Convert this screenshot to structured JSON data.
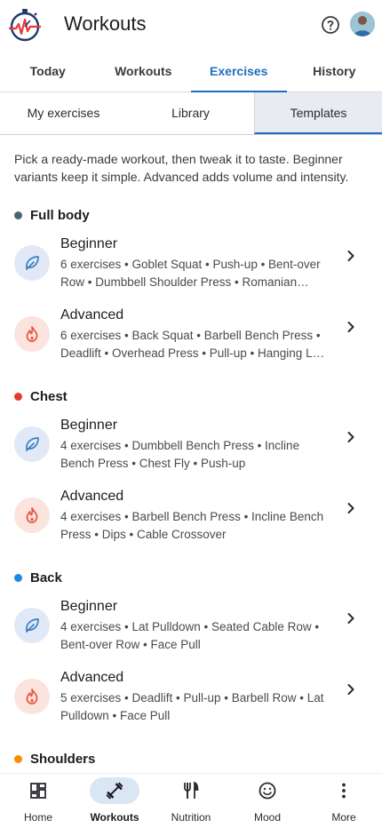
{
  "app": {
    "title": "Workouts"
  },
  "top_tabs": [
    {
      "label": "Today",
      "active": false
    },
    {
      "label": "Workouts",
      "active": false
    },
    {
      "label": "Exercises",
      "active": true
    },
    {
      "label": "History",
      "active": false
    }
  ],
  "sub_tabs": [
    {
      "label": "My exercises",
      "active": false
    },
    {
      "label": "Library",
      "active": false
    },
    {
      "label": "Templates",
      "active": true
    }
  ],
  "intro": "Pick a ready-made workout, then tweak it to taste. Beginner variants keep it simple. Advanced adds volume and intensity.",
  "sections": [
    {
      "title": "Full body",
      "color": "#4a6670",
      "templates": [
        {
          "level": "Beginner",
          "icon": "leaf-icon",
          "desc": "6 exercises • Goblet Squat • Push-up • Bent-over Row • Dumbbell Shoulder Press • Romanian Deadlift • Plank"
        },
        {
          "level": "Advanced",
          "icon": "flame-icon",
          "desc": "6 exercises • Back Squat • Barbell Bench Press • Deadlift • Overhead Press • Pull-up • Hanging Leg Raise"
        }
      ]
    },
    {
      "title": "Chest",
      "color": "#e53935",
      "templates": [
        {
          "level": "Beginner",
          "icon": "leaf-icon",
          "desc": "4 exercises • Dumbbell Bench Press • Incline Bench Press • Chest Fly • Push-up"
        },
        {
          "level": "Advanced",
          "icon": "flame-icon",
          "desc": "4 exercises • Barbell Bench Press • Incline Bench Press • Dips • Cable Crossover"
        }
      ]
    },
    {
      "title": "Back",
      "color": "#1e88e5",
      "templates": [
        {
          "level": "Beginner",
          "icon": "leaf-icon",
          "desc": "4 exercises • Lat Pulldown • Seated Cable Row • Bent-over Row • Face Pull"
        },
        {
          "level": "Advanced",
          "icon": "flame-icon",
          "desc": "5 exercises • Deadlift • Pull-up • Barbell Row • Lat Pulldown • Face Pull"
        }
      ]
    },
    {
      "title": "Shoulders",
      "color": "#fb8c00",
      "templates": []
    }
  ],
  "bottom_nav": [
    {
      "label": "Home",
      "icon": "dashboard-icon",
      "active": false
    },
    {
      "label": "Workouts",
      "icon": "fitness-icon",
      "active": true
    },
    {
      "label": "Nutrition",
      "icon": "utensils-icon",
      "active": false
    },
    {
      "label": "Mood",
      "icon": "smiley-icon",
      "active": false
    },
    {
      "label": "More",
      "icon": "more-vertical-icon",
      "active": false
    }
  ],
  "colors": {
    "accent": "#1e6fc1",
    "beginner_icon": "#3d7fc4",
    "advanced_icon": "#e8533b"
  }
}
